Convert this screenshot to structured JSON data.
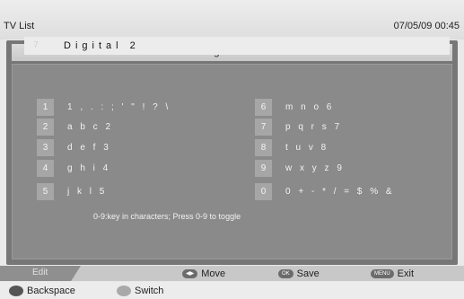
{
  "header": {
    "title": "TV List",
    "datetime": "07/05/09 00:45"
  },
  "panel": {
    "title": "Program Name",
    "field_lead": "7",
    "field_value": "Digital  2",
    "keys_left": [
      {
        "num": "1",
        "chars": "1 , . : ; ' \" ! ? \\"
      },
      {
        "num": "2",
        "chars": "a b c 2"
      },
      {
        "num": "3",
        "chars": "d e f 3"
      },
      {
        "num": "4",
        "chars": "g h i 4"
      },
      {
        "num": "5",
        "chars": "j k l 5"
      }
    ],
    "keys_right": [
      {
        "num": "6",
        "chars": "m n o 6"
      },
      {
        "num": "7",
        "chars": "p q r s 7"
      },
      {
        "num": "8",
        "chars": "t u v 8"
      },
      {
        "num": "9",
        "chars": "w x y z 9"
      },
      {
        "num": "0",
        "chars": "0 + - * / = $ % &"
      }
    ],
    "hint": "0-9:key in characters;  Press 0-9 to toggle"
  },
  "footer": {
    "edit_label": "Edit",
    "move_badge": "◀▶",
    "move_label": "Move",
    "save_badge": "OK",
    "save_label": "Save",
    "exit_badge": "MENU",
    "exit_label": "Exit"
  },
  "color_keys": {
    "backspace": {
      "label": "Backspace",
      "color": "#555555"
    },
    "switch": {
      "label": "Switch",
      "color": "#a9a9a9"
    }
  }
}
